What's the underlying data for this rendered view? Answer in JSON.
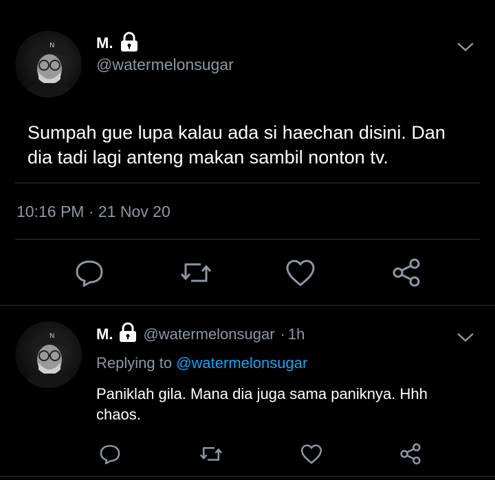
{
  "main_tweet": {
    "display_name": "M.",
    "handle": "@watermelonsugar",
    "text_line1": "Sumpah gue lupa kalau ada si haechan disini. Dan",
    "text_line2": "dia tadi lagi anteng makan sambil nonton tv.",
    "timestamp": "10:16 PM · 21 Nov 20",
    "actions": [
      "reply-icon",
      "retweet-icon",
      "like-icon",
      "share-icon"
    ]
  },
  "reply_tweet": {
    "display_name": "M.",
    "handle": "@watermelonsugar",
    "time_sep": "·",
    "time": "1h",
    "replying_prefix": "Replying to",
    "replying_handle": "@watermelonsugar",
    "text_line1": "Paniklah gila. Mana dia juga sama paniknya. Hhh",
    "text_line2": "chaos.",
    "actions": [
      "reply-icon",
      "retweet-icon",
      "like-icon",
      "share-icon"
    ]
  },
  "colors": {
    "background": "#000000",
    "text": "#ffffff",
    "muted": "#8b98a5",
    "link": "#1da1f2",
    "divider": "#2f3336"
  }
}
